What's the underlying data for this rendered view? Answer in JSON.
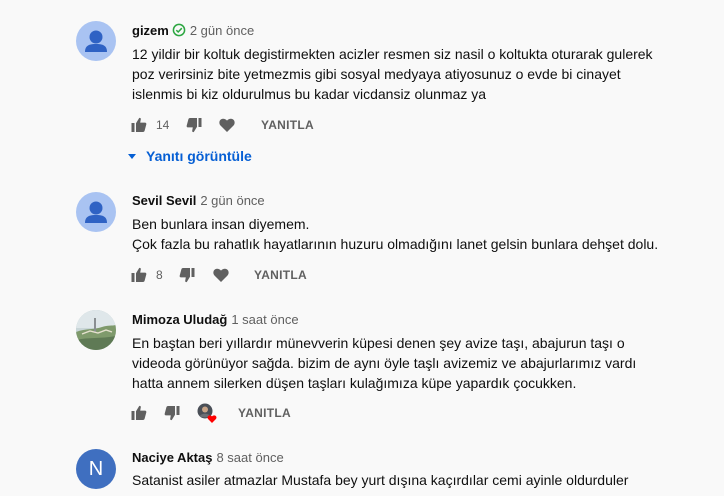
{
  "colors": {
    "link_blue": "#065fd4",
    "secondary_text": "#606060",
    "default_avatar": "#a9c3f2",
    "letter_avatar": "#3f6fc0",
    "heart_red": "#ff0000"
  },
  "comments": [
    {
      "author": "gizem",
      "verified_icon": "check-circle-icon",
      "time": "2 gün önce",
      "lines": [
        "12 yildir bir koltuk degistirmekten acizler resmen siz nasil o koltukta oturarak gulerek",
        "poz verirsiniz bite yetmezmis gibi sosyal medyaya atiyosunuz o evde bi cinayet",
        "islenmis bi kiz oldurulmus bu kadar vicdansiz olunmaz ya"
      ],
      "likes": "14",
      "reply_label": "YANITLA",
      "replies_toggle": "Yanıtı görüntüle"
    },
    {
      "author": "Sevil Sevil",
      "time": "2 gün önce",
      "lines": [
        "Ben bunlara insan diyemem.",
        "Çok fazla bu rahatlık hayatlarının huzuru olmadığını lanet gelsin bunlara dehşet dolu."
      ],
      "likes": "8",
      "reply_label": "YANITLA"
    },
    {
      "author": "Mimoza Uludağ",
      "time": "1 saat önce",
      "lines": [
        "En baştan beri yıllardır münevverin küpesi denen şey avize taşı, abajurun taşı o",
        "videoda görünüyor sağda.  bizim de aynı öyle taşlı avizemiz ve abajurlarımız vardı",
        "hatta annem silerken düşen taşları kulağımıza küpe yapardık çocukken."
      ],
      "likes": "",
      "reply_label": "YANITLA"
    },
    {
      "author": "Naciye Aktaş",
      "avatar_letter": "N",
      "time": "8 saat önce",
      "lines": [
        "Satanist asiler atmazlar Mustafa bey yurt dışına kaçırdılar cemi ayinle oldurduler"
      ]
    }
  ]
}
